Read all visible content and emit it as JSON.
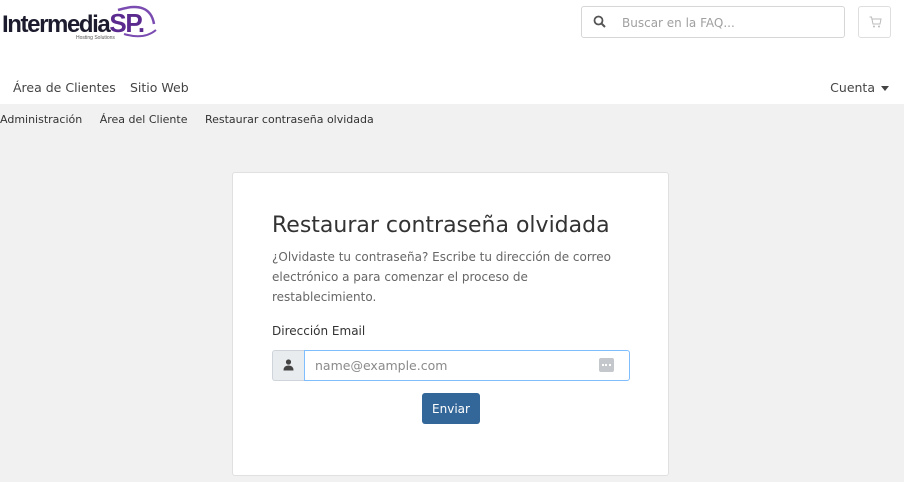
{
  "brand": {
    "logo_main": "Intermedia",
    "logo_accent": "SP.",
    "logo_tagline": "Hosting Solutions",
    "accent_color": "#5b2a8f"
  },
  "search": {
    "placeholder": "Buscar en la FAQ..."
  },
  "nav": {
    "items": [
      {
        "label": "Área de Clientes"
      },
      {
        "label": "Sitio Web"
      }
    ],
    "account_label": "Cuenta"
  },
  "breadcrumb": [
    "Administración",
    "Área del Cliente",
    "Restaurar contraseña olvidada"
  ],
  "form": {
    "title": "Restaurar contraseña olvidada",
    "description": "¿Olvidaste tu contraseña? Escribe tu dirección de correo electrónico a para comenzar el proceso de restablecimiento.",
    "email_label": "Dirección Email",
    "email_placeholder": "name@example.com",
    "email_value": "",
    "submit_label": "Enviar",
    "submit_color": "#336699"
  },
  "icons": {
    "search": "search-icon",
    "cart": "cart-icon",
    "user": "user-icon",
    "autofill": "autofill-icon"
  }
}
